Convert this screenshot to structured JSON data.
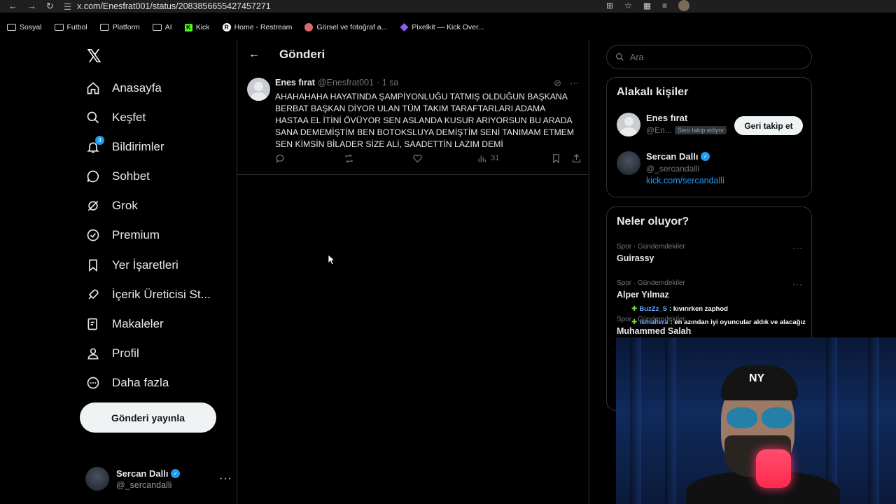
{
  "browser": {
    "url": "x.com/Enesfrat001/status/2083856655427457271",
    "bookmarks": [
      {
        "label": "Sosyal",
        "icon": "folder-icon"
      },
      {
        "label": "Futbol",
        "icon": "folder-icon"
      },
      {
        "label": "Platform",
        "icon": "folder-icon"
      },
      {
        "label": "AI",
        "icon": "folder-icon"
      },
      {
        "label": "Kick",
        "icon": "kick-icon"
      },
      {
        "label": "Home - Restream",
        "icon": "restream-icon"
      },
      {
        "label": "Görsel ve fotoğraf a...",
        "icon": "image-site-icon"
      },
      {
        "label": "Pixelkit — Kick Over...",
        "icon": "pixelkit-icon"
      }
    ]
  },
  "sidebar": {
    "logo": "𝕏",
    "nav": [
      {
        "label": "Anasayfa",
        "icon": "home-icon"
      },
      {
        "label": "Keşfet",
        "icon": "search-icon"
      },
      {
        "label": "Bildirimler",
        "icon": "bell-icon",
        "badge": "3"
      },
      {
        "label": "Sohbet",
        "icon": "chat-icon"
      },
      {
        "label": "Grok",
        "icon": "grok-icon"
      },
      {
        "label": "Premium",
        "icon": "premium-icon"
      },
      {
        "label": "Yer İşaretleri",
        "icon": "bookmark-icon"
      },
      {
        "label": "İçerik Üreticisi St...",
        "icon": "rocket-icon"
      },
      {
        "label": "Makaleler",
        "icon": "article-icon"
      },
      {
        "label": "Profil",
        "icon": "person-icon"
      },
      {
        "label": "Daha fazla",
        "icon": "more-icon"
      }
    ],
    "post_button": "Gönderi yayınla",
    "account": {
      "name": "Sercan Dallı",
      "handle": "@_sercandalli"
    }
  },
  "main": {
    "title": "Gönderi",
    "tweet": {
      "author": "Enes fırat",
      "handle": "@Enesfrat001",
      "time": "· 1 sa",
      "text": "AHAHAHAHA HAYATINDA ŞAMPİYONLUĞU TATMIŞ OLDUĞUN BAŞKANA BERBAT BAŞKAN DİYOR ULAN TÜM TAKIM TARAFTARLARI ADAMA HASTAA EL İTİNİ ÖVÜYOR SEN ASLANDA KUSUR ARIYORSUN BU ARADA SANA DEMEMİŞTİM BEN BOTOKSLUYA DEMİŞTİM SENİ TANIMAM ETMEM SEN KİMSİN BİLADER SİZE ALİ, SAADETTİN LAZIM DEMİ",
      "views": "31"
    }
  },
  "right": {
    "search_placeholder": "Ara",
    "related": {
      "title": "Alakalı kişiler",
      "people": [
        {
          "name": "Enes fırat",
          "handle": "@En...",
          "tag": "Seni takip ediyor",
          "button": "Geri takip et"
        },
        {
          "name": "Sercan Dallı",
          "handle": "@_sercandalli",
          "link": "kick.com/sercandalli"
        }
      ]
    },
    "trends": {
      "title": "Neler oluyor?",
      "items": [
        {
          "category": "Spor · Gündemdekiler",
          "title": "Guirassy"
        },
        {
          "category": "Spor · Gündemdekiler",
          "title": "Alper Yılmaz"
        },
        {
          "category": "Spor · Gündemdekiler",
          "title": "Muhammed Salah"
        }
      ]
    }
  },
  "overlay_chat": [
    {
      "user": "BuzZz_S",
      "message": ": kıvırırken zaphod"
    },
    {
      "user": "ismailera",
      "message": ": en azından iyi oyuncular aldık ve alacağız"
    }
  ],
  "webcam": {
    "cap_logo": "NY"
  },
  "colors": {
    "accent": "#1d9bf0",
    "bg": "#000000",
    "border": "#2f3336",
    "muted": "#71767b"
  }
}
